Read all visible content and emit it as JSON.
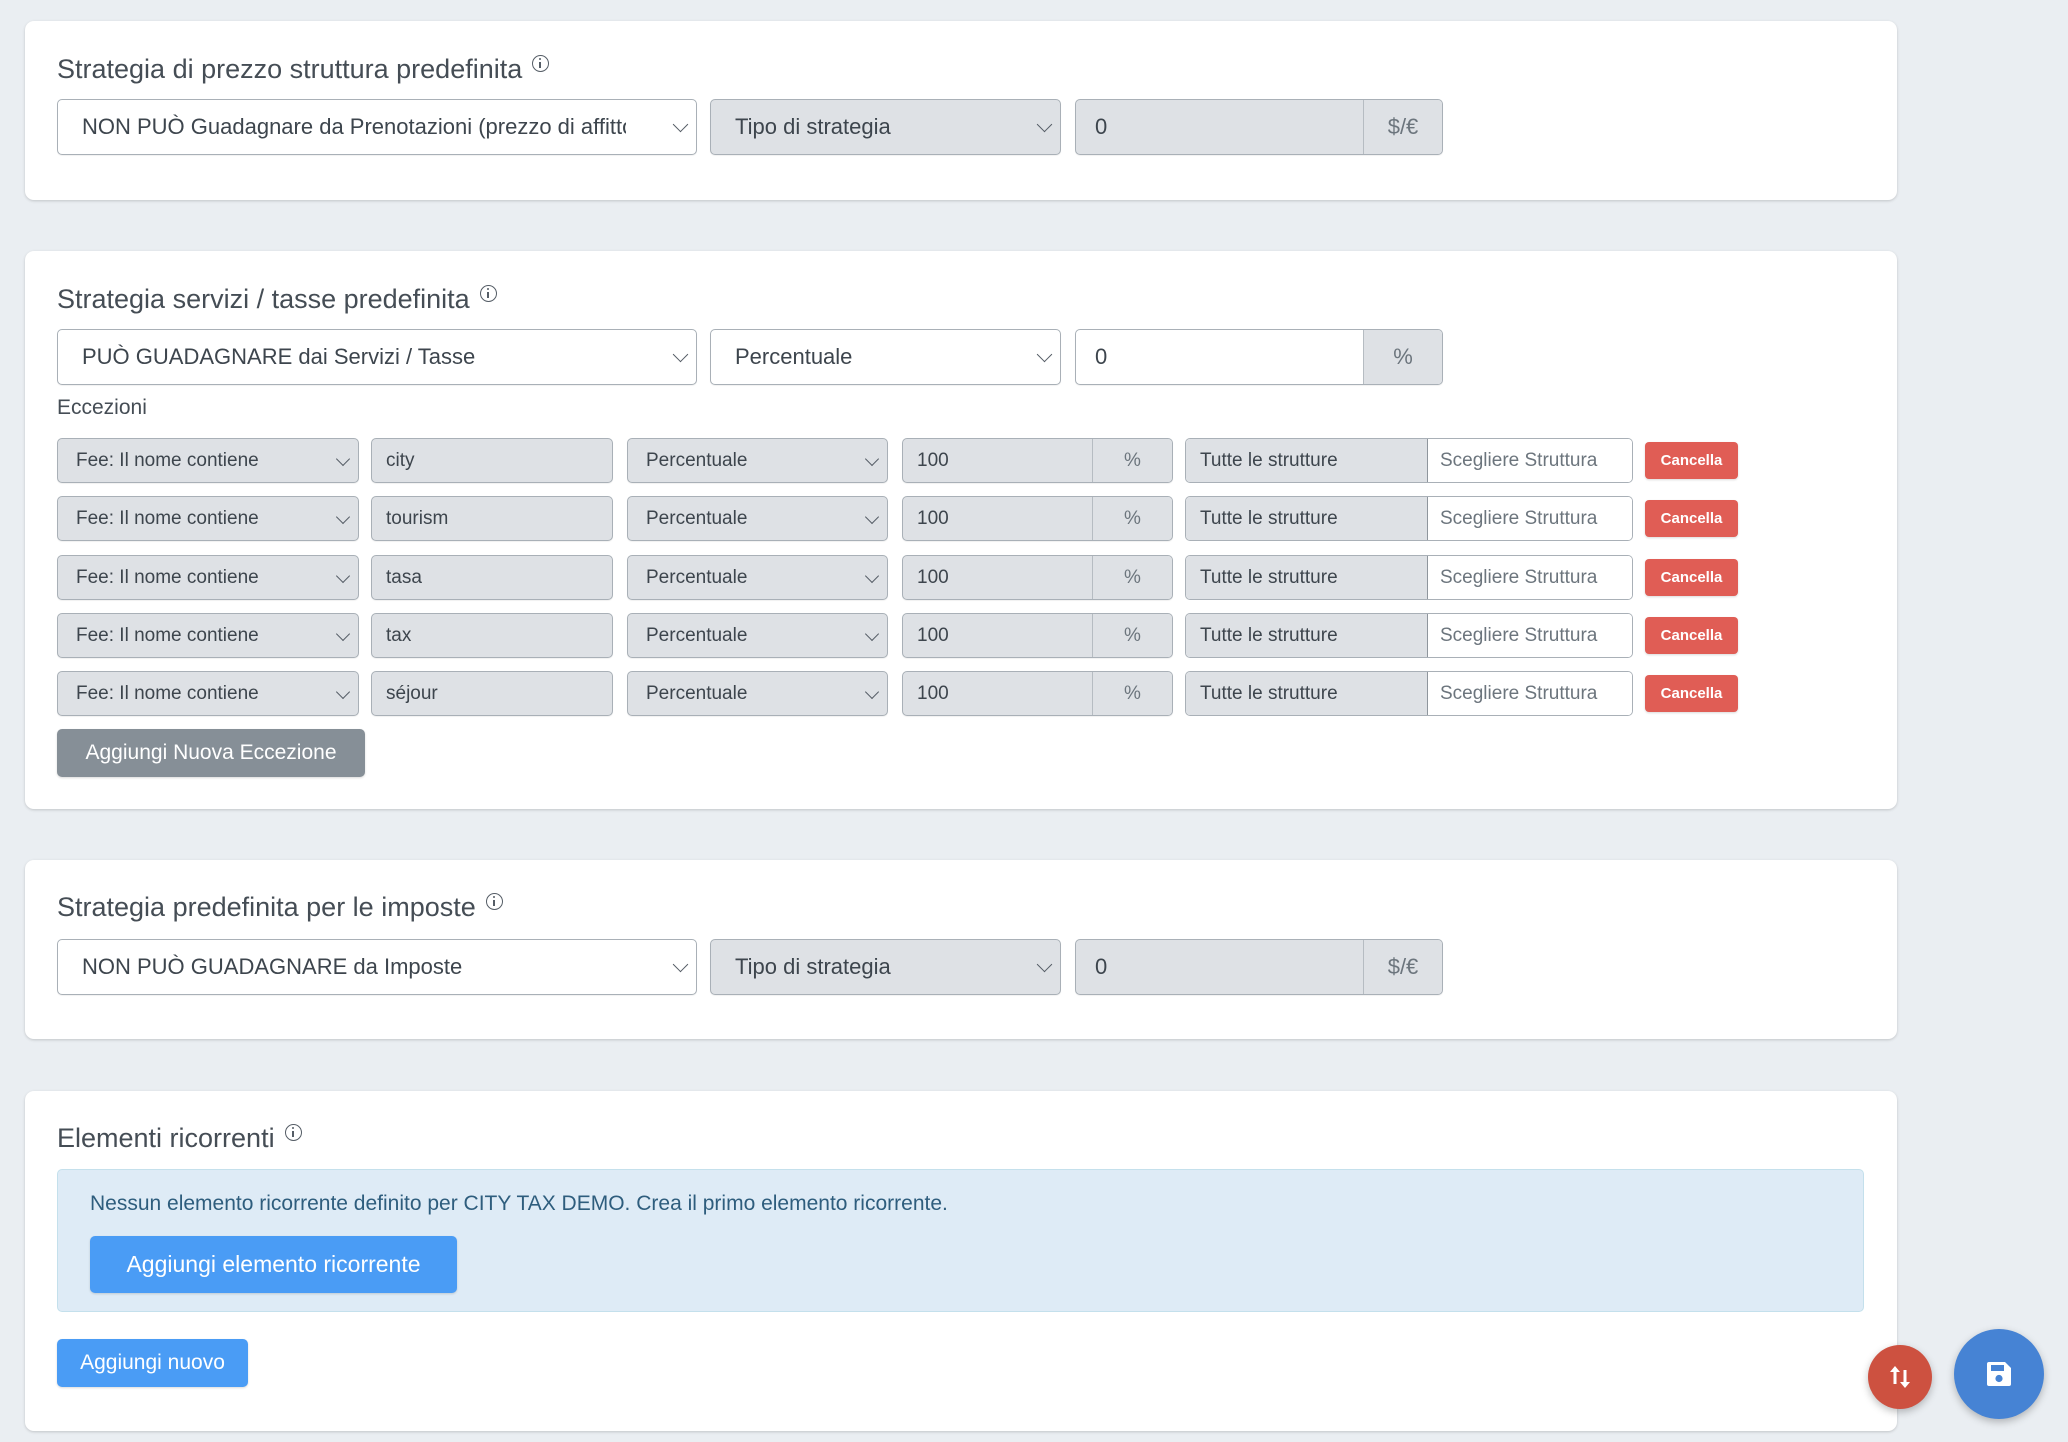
{
  "sections": {
    "property_price": {
      "title": "Strategia di prezzo struttura predefinita",
      "strategy_select": "NON PUÒ Guadagnare da Prenotazioni (prezzo di affitto)",
      "type_select": "Tipo di strategia",
      "value": "0",
      "suffix": "$/€"
    },
    "services_fees": {
      "title": "Strategia servizi / tasse predefinita",
      "strategy_select": "PUÒ GUADAGNARE dai Servizi / Tasse",
      "type_select": "Percentuale",
      "value": "0",
      "suffix": "%",
      "exceptions_label": "Eccezioni",
      "exceptions": [
        {
          "condition": "Fee: Il nome contiene",
          "keyword": "city",
          "type": "Percentuale",
          "value": "100",
          "suffix": "%",
          "properties": "Tutte le strutture",
          "choose_placeholder": "Scegliere Struttura",
          "delete_label": "Cancella"
        },
        {
          "condition": "Fee: Il nome contiene",
          "keyword": "tourism",
          "type": "Percentuale",
          "value": "100",
          "suffix": "%",
          "properties": "Tutte le strutture",
          "choose_placeholder": "Scegliere Struttura",
          "delete_label": "Cancella"
        },
        {
          "condition": "Fee: Il nome contiene",
          "keyword": "tasa",
          "type": "Percentuale",
          "value": "100",
          "suffix": "%",
          "properties": "Tutte le strutture",
          "choose_placeholder": "Scegliere Struttura",
          "delete_label": "Cancella"
        },
        {
          "condition": "Fee: Il nome contiene",
          "keyword": "tax",
          "type": "Percentuale",
          "value": "100",
          "suffix": "%",
          "properties": "Tutte le strutture",
          "choose_placeholder": "Scegliere Struttura",
          "delete_label": "Cancella"
        },
        {
          "condition": "Fee: Il nome contiene",
          "keyword": "séjour",
          "type": "Percentuale",
          "value": "100",
          "suffix": "%",
          "properties": "Tutte le strutture",
          "choose_placeholder": "Scegliere Struttura",
          "delete_label": "Cancella"
        }
      ],
      "add_exception_label": "Aggiungi Nuova Eccezione"
    },
    "taxes": {
      "title": "Strategia predefinita per le imposte",
      "strategy_select": "NON PUÒ GUADAGNARE da Imposte",
      "type_select": "Tipo di strategia",
      "value": "0",
      "suffix": "$/€"
    },
    "recurring": {
      "title": "Elementi ricorrenti",
      "empty_message": "Nessun elemento ricorrente definito per CITY TAX DEMO. Crea il primo elemento ricorrente.",
      "add_recurring_label": "Aggiungi elemento ricorrente",
      "add_new_label": "Aggiungi nuovo"
    }
  },
  "fabs": {
    "sort_icon": "arrow-up-down-icon",
    "save_icon": "floppy-disk-icon"
  },
  "colors": {
    "background": "#eaeef2",
    "primary": "#4a9cf5",
    "danger": "#e05d55",
    "secondary": "#868f97",
    "fab_red": "#cd5140",
    "fab_blue": "#4683d4",
    "alert_bg": "#deebf6"
  }
}
